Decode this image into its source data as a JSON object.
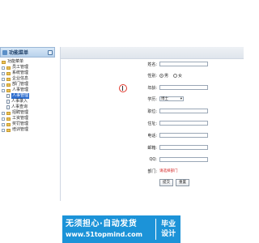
{
  "sidebar": {
    "title": "功能菜单",
    "items": [
      {
        "label": "功能菜单",
        "level": 0,
        "type": "folder"
      },
      {
        "label": "员工管理",
        "level": 0,
        "type": "group"
      },
      {
        "label": "系统管理",
        "level": 0,
        "type": "group"
      },
      {
        "label": "企业信息",
        "level": 0,
        "type": "group"
      },
      {
        "label": "部门管理",
        "level": 0,
        "type": "group"
      },
      {
        "label": "人事管理",
        "level": 0,
        "type": "group"
      },
      {
        "label": "人事管理",
        "level": 1,
        "type": "doc",
        "selected": true
      },
      {
        "label": "人事录入",
        "level": 1,
        "type": "doc"
      },
      {
        "label": "人事查询",
        "level": 1,
        "type": "doc"
      },
      {
        "label": "招聘管理",
        "level": 0,
        "type": "group"
      },
      {
        "label": "工资管理",
        "level": 0,
        "type": "group"
      },
      {
        "label": "奖罚管理",
        "level": 0,
        "type": "group"
      },
      {
        "label": "培训管理",
        "level": 0,
        "type": "group"
      }
    ]
  },
  "form": {
    "name_label": "姓名:",
    "gender_label": "性别:",
    "gender_male": "男",
    "gender_female": "女",
    "age_label": "年龄:",
    "age_value": "",
    "education_label": "学历:",
    "education_value": "博士",
    "position_label": "职位:",
    "address_label": "住址:",
    "phone_label": "电话:",
    "email_label": "邮箱:",
    "qq_label": "QQ:",
    "department_label": "部门:",
    "department_hint": "请选择部门",
    "submit_label": "提交",
    "reset_label": "重置"
  },
  "watermark": {
    "line1": "无须担心·自动发货",
    "line2": "www.51topmind.com",
    "right1": "毕业",
    "right2": "设计"
  },
  "colors": {
    "watermark_bg": "#1c93d8",
    "hint": "#d21f1f",
    "cursor_circle": "#e23a2e"
  }
}
